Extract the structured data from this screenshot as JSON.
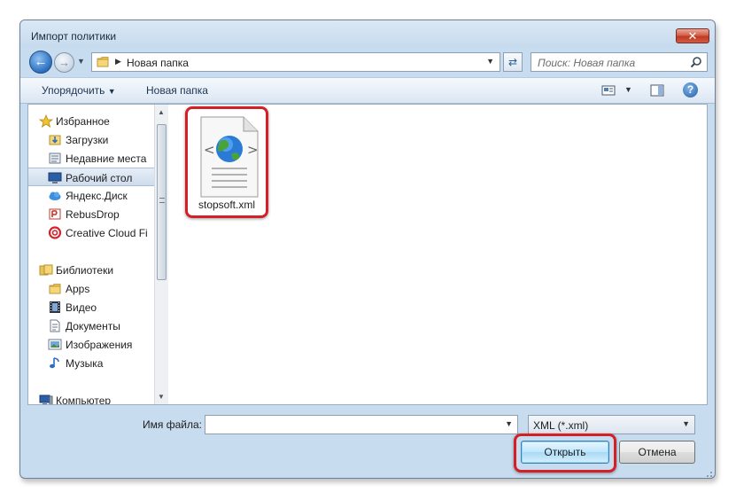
{
  "window": {
    "title": "Импорт политики",
    "close_label": "✕"
  },
  "address": {
    "path": "Новая папка",
    "search_placeholder": "Поиск: Новая папка"
  },
  "toolbar": {
    "organize_label": "Упорядочить",
    "new_folder_label": "Новая папка"
  },
  "nav": {
    "favorites": {
      "label": "Избранное",
      "items": [
        "Загрузки",
        "Недавние места",
        "Рабочий стол",
        "Яндекс.Диск",
        "RebusDrop",
        "Creative Cloud Fi"
      ]
    },
    "libraries": {
      "label": "Библиотеки",
      "items": [
        "Apps",
        "Видео",
        "Документы",
        "Изображения",
        "Музыка"
      ]
    },
    "computer": {
      "label": "Компьютер"
    },
    "selected": "Рабочий стол"
  },
  "files": [
    {
      "name": "stopsoft.xml",
      "type": "xml"
    }
  ],
  "footer": {
    "filename_label": "Имя файла:",
    "filename_value": "",
    "filetype_value": "XML (*.xml)",
    "open_label": "Открыть",
    "cancel_label": "Отмена"
  },
  "colors": {
    "highlight": "#d41f26",
    "accent": "#3c7fb1",
    "frame": "#c7dcee"
  }
}
